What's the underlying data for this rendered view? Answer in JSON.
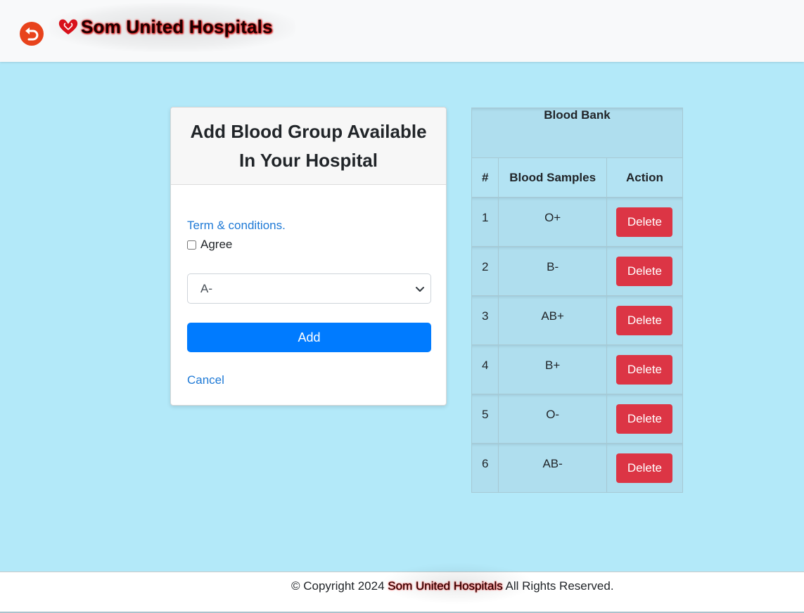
{
  "header": {
    "back_icon": "undo-arrow-icon",
    "brand_icon": "heart-hands-icon",
    "brand_name": "Som United Hospitals",
    "colors": {
      "back_button": "#e8431c",
      "brand_glow": "#e31212"
    }
  },
  "form": {
    "title": "Add Blood Group Available In Your Hospital",
    "terms_link": "Term & conditions.",
    "agree_label": "Agree",
    "agree_checked": false,
    "blood_group_select": {
      "selected": "A-"
    },
    "add_label": "Add",
    "cancel_label": "Cancel",
    "colors": {
      "add_button": "#007bff",
      "link": "#1f7ad6"
    }
  },
  "blood_bank": {
    "title": "Blood Bank",
    "columns": [
      "#",
      "Blood Samples",
      "Action"
    ],
    "delete_label": "Delete",
    "rows": [
      {
        "num": "1",
        "sample": "O+"
      },
      {
        "num": "2",
        "sample": "B-"
      },
      {
        "num": "3",
        "sample": "AB+"
      },
      {
        "num": "4",
        "sample": "B+"
      },
      {
        "num": "5",
        "sample": "O-"
      },
      {
        "num": "6",
        "sample": "AB-"
      }
    ],
    "colors": {
      "delete_button": "#dc3545",
      "table_bg": "#b0dff0"
    }
  },
  "footer": {
    "prefix": "© Copyright 2024 ",
    "brand": "Som United Hospitals",
    "suffix": " All Rights Reserved."
  },
  "page": {
    "background": "#b3e9f9"
  }
}
